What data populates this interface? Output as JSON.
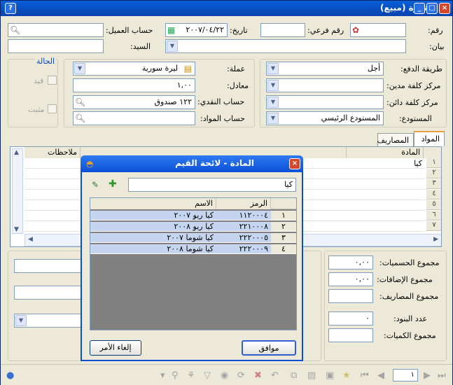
{
  "window": {
    "title": "فاتورة (مبيع)"
  },
  "form": {
    "number_label": "رقم:",
    "branch_number_label": "رقم فرعي:",
    "date_label": "تاريخ:",
    "date_value": "٢٠٠٧/٠٤/٢٢",
    "customer_account_label": "حساب العميل:",
    "statement_label": "بيان:",
    "mister_label": "السيد:",
    "status_label": "الحالة",
    "posted_label": "قيد",
    "fixed_label": "مثبت",
    "payment_method_label": "طريقة الدفع:",
    "payment_method_value": "أجل",
    "currency_label": "عملة:",
    "currency_value": "ليرة سورية",
    "debit_cost_center_label": "مركز كلفة مدين:",
    "exchange_rate_label": "معادل:",
    "exchange_rate_value": "١,٠٠",
    "credit_cost_center_label": "مركز كلفة دائن:",
    "cash_account_label": "حساب النقدي:",
    "cash_account_value": "١٢٢ صندوق",
    "warehouse_label": "المستودع:",
    "warehouse_value": "المستودع الرئيسي",
    "materials_account_label": "حساب المواد:"
  },
  "tabs": [
    "المواد",
    "المصاريف"
  ],
  "grid": {
    "columns": [
      "المادة",
      "ملاحظات"
    ],
    "rows": [
      {
        "num": "١",
        "material": "كيا"
      },
      {
        "num": "٢",
        "material": ""
      },
      {
        "num": "٣",
        "material": ""
      },
      {
        "num": "٤",
        "material": ""
      },
      {
        "num": "٥",
        "material": ""
      },
      {
        "num": "٦",
        "material": ""
      },
      {
        "num": "٧",
        "material": ""
      }
    ]
  },
  "totals": {
    "discounts_label": "مجموع الحسميات:",
    "discounts_value": "٠,٠٠",
    "additions_label": "مجموع الإضافات:",
    "additions_value": "٠,٠٠",
    "expenses_label": "مجموع المصاريف:",
    "items_count_label": "عدد البنود:",
    "items_count_value": "٠",
    "quantities_label": "مجموع الكميات:"
  },
  "dialog": {
    "title": "المادة - لائحة القيم",
    "search_value": "كيا",
    "columns": {
      "code": "الرمز",
      "name": "الاسم"
    },
    "rows": [
      {
        "num": "١",
        "code": "١١٢٠٠٠٤",
        "name": "كيا ريو ٢٠٠٧"
      },
      {
        "num": "٢",
        "code": "٢٢١٠٠٠٨",
        "name": "كيا ريو ٢٠٠٨"
      },
      {
        "num": "٣",
        "code": "٢٢٢٠٠٠٥",
        "name": "كيا شوما ٢٠٠٧"
      },
      {
        "num": "٤",
        "code": "٢٢٢٠٠٠٩",
        "name": "كيا شوما ٢٠٠٨"
      }
    ],
    "ok_label": "موافق",
    "cancel_label": "إلغاء الأمر"
  },
  "statusbar": {
    "page_value": "١"
  }
}
